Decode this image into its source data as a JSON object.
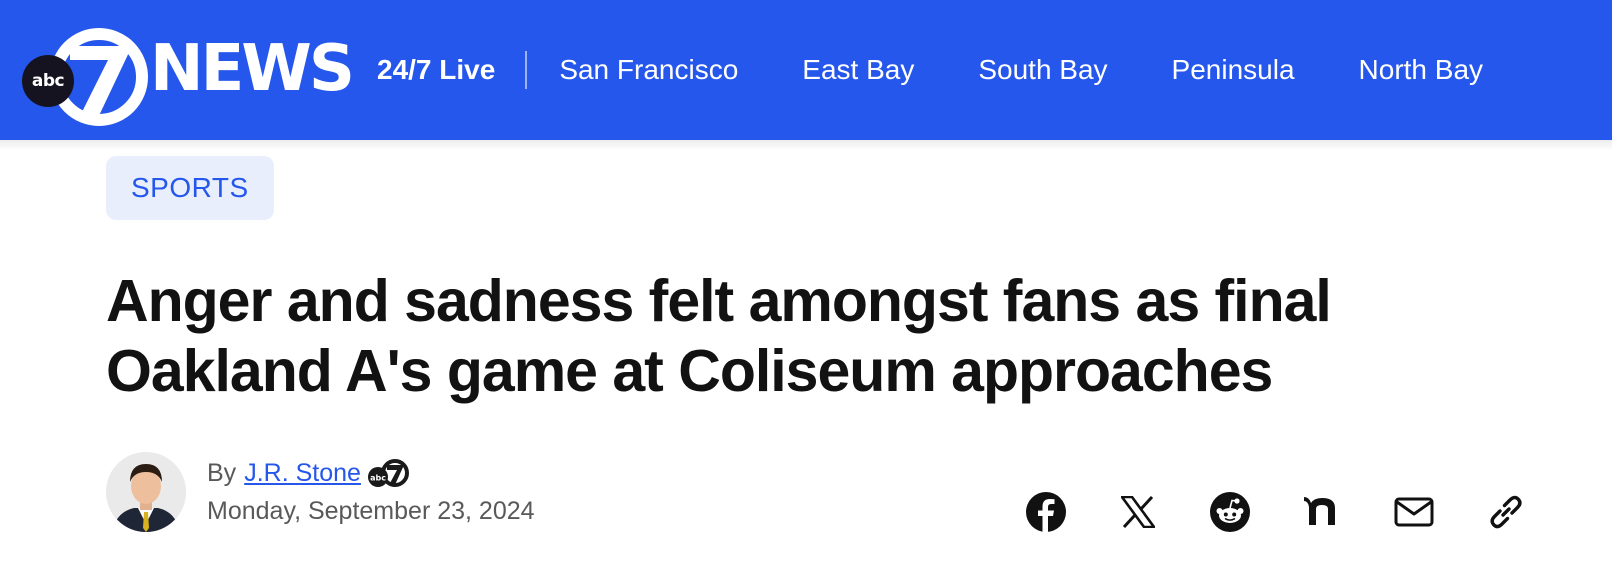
{
  "brand": {
    "network": "abc",
    "channel_number": "7",
    "wordmark": "NEWS",
    "bar_color": "#2557ec"
  },
  "nav": {
    "live": "24/7 Live",
    "regions": [
      "San Francisco",
      "East Bay",
      "South Bay",
      "Peninsula",
      "North Bay"
    ]
  },
  "article": {
    "category": "SPORTS",
    "headline": "Anger and sadness felt amongst fans as final Oakland A's game at Coliseum approaches",
    "byline_prefix": "By",
    "author": "J.R. Stone",
    "date": "Monday, September 23, 2024"
  },
  "share": {
    "icons": [
      "facebook-icon",
      "x-icon",
      "reddit-icon",
      "nextdoor-icon",
      "email-icon",
      "link-icon"
    ]
  },
  "colors": {
    "accent": "#2557ec",
    "pill_background": "#e8eefc",
    "headline": "#121212",
    "meta_text": "#595959"
  }
}
